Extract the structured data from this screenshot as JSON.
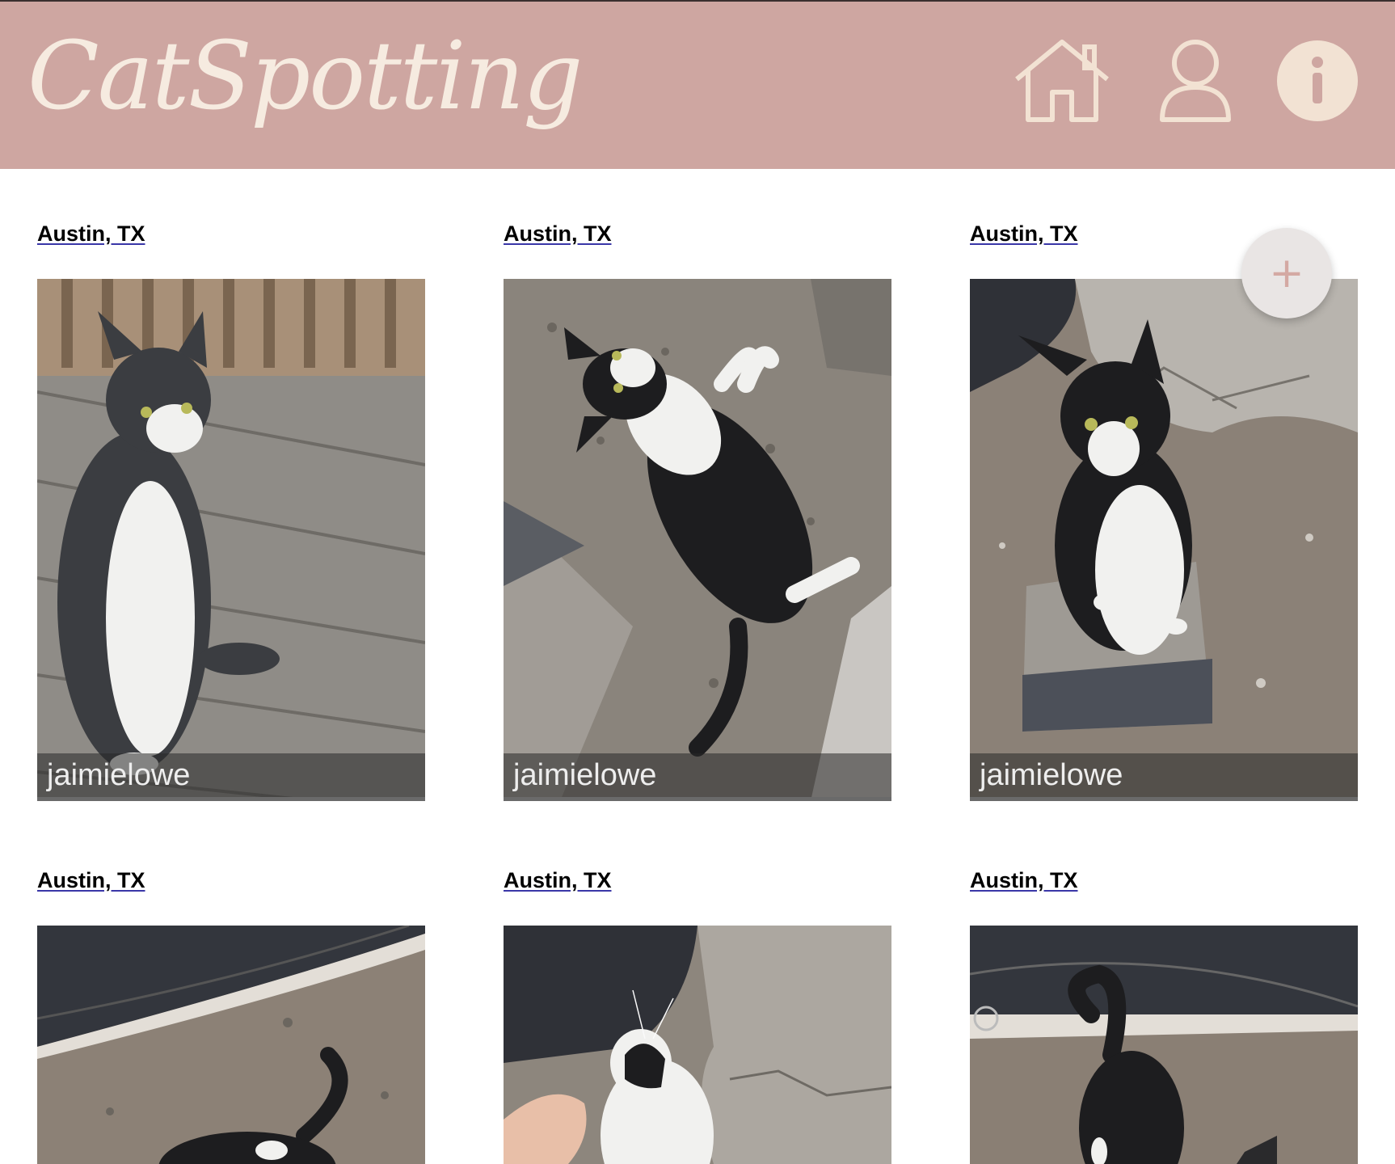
{
  "header": {
    "logo_text": "CatSpotting",
    "nav": [
      {
        "icon": "home-icon"
      },
      {
        "icon": "user-icon"
      },
      {
        "icon": "info-icon"
      }
    ],
    "background_color": "#cea6a1",
    "accent_color": "#f6ebe0"
  },
  "fab": {
    "label": "+",
    "icon": "plus-icon"
  },
  "posts": [
    {
      "location": "Austin, TX",
      "username": "jaimielowe"
    },
    {
      "location": "Austin, TX",
      "username": "jaimielowe"
    },
    {
      "location": "Austin, TX",
      "username": "jaimielowe"
    },
    {
      "location": "Austin, TX"
    },
    {
      "location": "Austin, TX"
    },
    {
      "location": "Austin, TX"
    }
  ]
}
